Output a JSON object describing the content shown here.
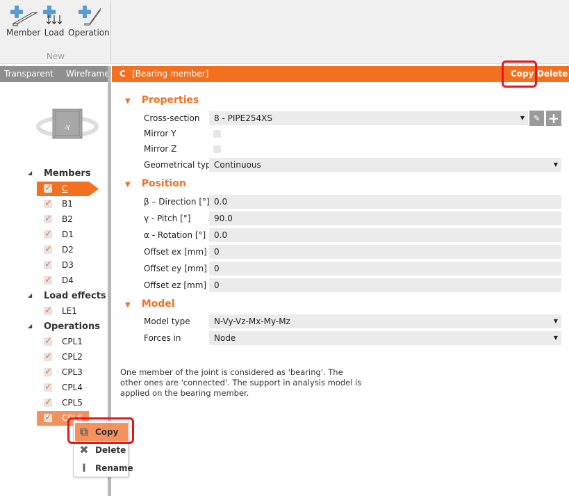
{
  "toolbar": {
    "member": "Member",
    "load": "Load",
    "operation": "Operation",
    "group": "New"
  },
  "view": {
    "transparent": "Transparent",
    "wireframe": "Wireframe"
  },
  "navcube": {
    "label": "-Y"
  },
  "header": {
    "name": "C",
    "subtitle": "[Bearing member]",
    "copy": "Copy",
    "delete": "Delete",
    "color": "#f37021"
  },
  "tree": {
    "members": {
      "label": "Members",
      "items": [
        "C",
        "B1",
        "B2",
        "D1",
        "D2",
        "D3",
        "D4"
      ]
    },
    "load_effects": {
      "label": "Load effects",
      "items": [
        "LE1"
      ]
    },
    "operations": {
      "label": "Operations",
      "items": [
        "CPL1",
        "CPL2",
        "CPL3",
        "CPL4",
        "CPL5",
        "CPL6"
      ]
    }
  },
  "properties": {
    "title": "Properties",
    "cross_section_label": "Cross-section",
    "cross_section": "8 - PIPE254XS",
    "mirror_y_label": "Mirror Y",
    "mirror_y": false,
    "mirror_z_label": "Mirror Z",
    "mirror_z": false,
    "geom_label": "Geometrical type",
    "geom": "Continuous"
  },
  "position": {
    "title": "Position",
    "rows": [
      {
        "label": "β – Direction [°]",
        "value": "0.0"
      },
      {
        "label": "γ - Pitch [°]",
        "value": "90.0"
      },
      {
        "label": "α - Rotation [°]",
        "value": "0.0"
      },
      {
        "label": "Offset ex [mm]",
        "value": "0"
      },
      {
        "label": "Offset ey [mm]",
        "value": "0"
      },
      {
        "label": "Offset ez [mm]",
        "value": "0"
      }
    ]
  },
  "model": {
    "title": "Model",
    "type_label": "Model type",
    "type": "N-Vy-Vz-Mx-My-Mz",
    "forces_label": "Forces in",
    "forces": "Node"
  },
  "description": "One member of the joint is considered as 'bearing'. The other ones are 'connected'. The support in analysis model is applied on the bearing member.",
  "context_menu": {
    "copy": "Copy",
    "delete": "Delete",
    "rename": "Rename"
  }
}
